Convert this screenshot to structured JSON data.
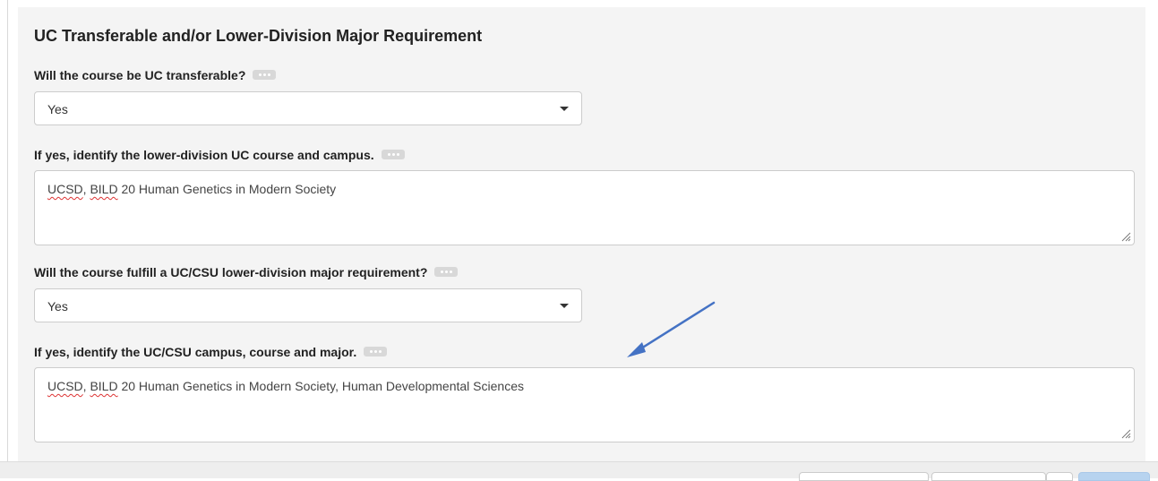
{
  "section": {
    "title": "UC Transferable and/or Lower-Division Major Requirement"
  },
  "questions": [
    {
      "label": "Will the course be UC transferable?",
      "type": "select",
      "value": "Yes"
    },
    {
      "label": "If yes, identify the lower-division UC course and campus.",
      "type": "textarea",
      "value_parts": [
        "UCSD",
        ", ",
        "BILD",
        " 20 Human Genetics in Modern Society"
      ]
    },
    {
      "label": "Will the course fulfill a UC/CSU lower-division major requirement?",
      "type": "select",
      "value": "Yes"
    },
    {
      "label": "If yes, identify the UC/CSU campus, course and major.",
      "type": "textarea",
      "value_parts": [
        "UCSD",
        ", ",
        "BILD",
        " 20 Human Genetics in Modern Society, Human Developmental Sciences"
      ]
    }
  ],
  "icons": {
    "more": "more-options-icon",
    "caret": "caret-down-icon",
    "resize": "resize-handle-icon",
    "annotation": "annotation-arrow-icon"
  },
  "colors": {
    "accent": "#4a86c8",
    "panel": "#f4f4f4",
    "spellcheck": "#dd3333"
  }
}
